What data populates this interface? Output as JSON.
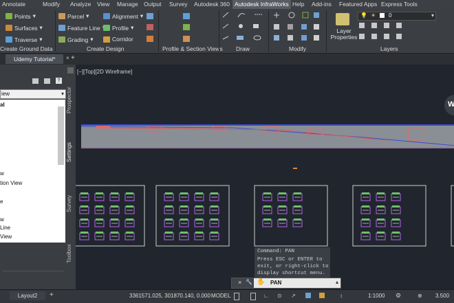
{
  "menu": {
    "items": [
      "Annotate",
      "Modify",
      "Analyze",
      "View",
      "Manage",
      "Output",
      "Survey",
      "Autodesk 360",
      "Autodesk InfraWorks",
      "Help",
      "Add-ins",
      "Featured Apps",
      "Express Tools"
    ],
    "active": "Autodesk InfraWorks"
  },
  "ribbon": {
    "ground_data": {
      "points": "Points",
      "surfaces": "Surfaces",
      "traverse": "Traverse",
      "panel_label": "Create Ground Data"
    },
    "design": {
      "parcel": "Parcel",
      "feature_line": "Feature Line",
      "grading": "Grading",
      "alignment": "Alignment",
      "profile": "Profile",
      "corridor": "Corridor",
      "panel_label": "Create Design"
    },
    "profile_section": {
      "panel_label": "Profile & Section Views"
    },
    "draw": {
      "panel_label": "Draw"
    },
    "modify": {
      "panel_label": "Modify"
    },
    "layers": {
      "layer_properties": "Layer Properties",
      "layer_value": "0",
      "panel_label": "Layers"
    }
  },
  "tabs": {
    "doc_tab": "Udemy Tutorial*",
    "add": "+"
  },
  "palette": {
    "dropdown_value": "iew",
    "tree": [
      "al",
      "",
      "",
      "",
      "",
      "",
      "",
      "w",
      "tion View",
      "",
      "e",
      "",
      "w",
      "Line",
      "View"
    ],
    "vertical_tabs": [
      "Prospector",
      "Settings",
      "Survey",
      "Toolbox"
    ]
  },
  "canvas": {
    "viewport_label": "[−][Top][2D Wireframe]",
    "navcube_letter": "W"
  },
  "command": {
    "history_1": "Command: PAN",
    "history_2": "Press ESC or ENTER to",
    "history_3": "exit, or right-click to",
    "history_4": "display shortcut menu.",
    "input": "PAN"
  },
  "layout_tabs": [
    "Layout2",
    "+"
  ],
  "status": {
    "coords": "3361571.025, 301870.140, 0.000",
    "model": "MODEL",
    "scale": "1:1000",
    "value": "3.500"
  }
}
